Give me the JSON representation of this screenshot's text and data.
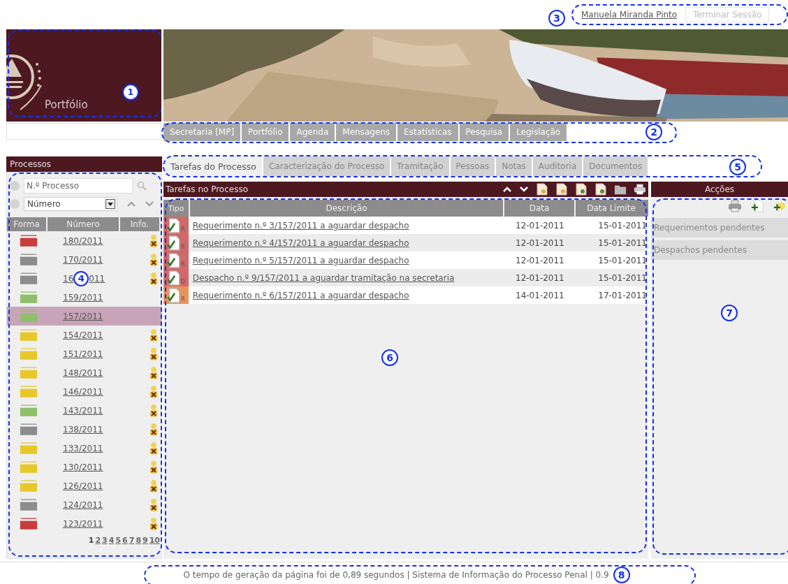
{
  "user": {
    "name": "Manuela Miranda Pinto",
    "logout": "Terminar Sessão",
    "callout": "3"
  },
  "brand": {
    "title": "Portfólio",
    "callout": "1"
  },
  "nav": {
    "callout": "2",
    "items": [
      {
        "label": "Secretaria [MP]"
      },
      {
        "label": "Portfólio"
      },
      {
        "label": "Agenda"
      },
      {
        "label": "Mensagens"
      },
      {
        "label": "Estatísticas"
      },
      {
        "label": "Pesquisa"
      },
      {
        "label": "Legislação"
      }
    ]
  },
  "processes": {
    "title": "Processos",
    "search_placeholder": "N.º Processo",
    "sort_value": "Número",
    "callout": "4",
    "columns": [
      "Forma",
      "Número",
      "Info."
    ],
    "rows": [
      {
        "number_parts": [
          "180/2011"
        ],
        "color": "#c83c3c",
        "info": true,
        "selected": false
      },
      {
        "number_parts": [
          "170/2011"
        ],
        "color": "#8c8c8c",
        "info": true,
        "selected": false
      },
      {
        "number_parts": [
          "16",
          "011"
        ],
        "color": "#8c8c8c",
        "info": true,
        "selected": false
      },
      {
        "number_parts": [
          "159/2011"
        ],
        "color": "#8fbf6a",
        "info": false,
        "selected": false
      },
      {
        "number_parts": [
          "157/2011"
        ],
        "color": "#8fbf6a",
        "info": false,
        "selected": true
      },
      {
        "number_parts": [
          "154/2011"
        ],
        "color": "#e6c82a",
        "info": true,
        "selected": false
      },
      {
        "number_parts": [
          "151/2011"
        ],
        "color": "#e6c82a",
        "info": true,
        "selected": false
      },
      {
        "number_parts": [
          "148/2011"
        ],
        "color": "#e6c82a",
        "info": true,
        "selected": false
      },
      {
        "number_parts": [
          "146/2011"
        ],
        "color": "#e6c82a",
        "info": true,
        "selected": false
      },
      {
        "number_parts": [
          "143/2011"
        ],
        "color": "#8fbf6a",
        "info": true,
        "selected": false
      },
      {
        "number_parts": [
          "138/2011"
        ],
        "color": "#8c8c8c",
        "info": true,
        "selected": false
      },
      {
        "number_parts": [
          "133/2011"
        ],
        "color": "#e6c82a",
        "info": true,
        "selected": false
      },
      {
        "number_parts": [
          "130/2011"
        ],
        "color": "#e6c82a",
        "info": true,
        "selected": false
      },
      {
        "number_parts": [
          "126/2011"
        ],
        "color": "#e6c82a",
        "info": true,
        "selected": false
      },
      {
        "number_parts": [
          "124/2011"
        ],
        "color": "#8c8c8c",
        "info": true,
        "selected": false
      },
      {
        "number_parts": [
          "123/2011"
        ],
        "color": "#c83c3c",
        "info": true,
        "selected": false
      }
    ],
    "pages": [
      {
        "label": "1",
        "selected": true
      },
      {
        "label": "2",
        "selected": false
      },
      {
        "label": "3",
        "selected": false
      },
      {
        "label": "4",
        "selected": false
      },
      {
        "label": "5",
        "selected": false
      },
      {
        "label": "6",
        "selected": false
      },
      {
        "label": "7",
        "selected": false
      },
      {
        "label": "8",
        "selected": false
      },
      {
        "label": "9",
        "selected": false
      },
      {
        "label": "10",
        "selected": false
      }
    ]
  },
  "tabs": {
    "callout": "5",
    "items": [
      {
        "label": "Tarefas do Processo",
        "selected": true
      },
      {
        "label": "Caracterização do Processo",
        "selected": false
      },
      {
        "label": "Tramitação",
        "selected": false
      },
      {
        "label": "Pessoas",
        "selected": false
      },
      {
        "label": "Notas",
        "selected": false
      },
      {
        "label": "Auditoria",
        "selected": false
      },
      {
        "label": "Documentos",
        "selected": false
      }
    ]
  },
  "tasks": {
    "title": "Tarefas no Processo",
    "callout": "6",
    "columns": [
      "Tipo",
      "Descrição",
      "Data",
      "Data Limite"
    ],
    "rows": [
      {
        "letter": "R",
        "color": "#d06a6a",
        "description": "Requerimento n.º 3/157/2011 a aguardar despacho",
        "date": "12-01-2011",
        "deadline": "15-01-2011"
      },
      {
        "letter": "R",
        "color": "#d06a6a",
        "description": "Requerimento n.º 4/157/2011 a aguardar despacho",
        "date": "12-01-2011",
        "deadline": "15-01-2011"
      },
      {
        "letter": "R",
        "color": "#d06a6a",
        "description": "Requerimento n.º 5/157/2011 a aguardar despacho",
        "date": "12-01-2011",
        "deadline": "15-01-2011"
      },
      {
        "letter": "D",
        "color": "#d06a6a",
        "description": "Despacho n.º 9/157/2011 a aguardar tramitação na secretaria",
        "date": "12-01-2011",
        "deadline": "15-01-2011"
      },
      {
        "letter": "R",
        "color": "#e8935a",
        "description": "Requerimento n.º 6/157/2011 a aguardar despacho",
        "date": "14-01-2011",
        "deadline": "17-01-2011"
      }
    ]
  },
  "actions": {
    "title": "Acções",
    "callout": "7",
    "buttons": [
      {
        "label": "Requerimentos pendentes",
        "disabled": true
      },
      {
        "label": "Despachos pendentes",
        "disabled": true
      }
    ]
  },
  "footer": {
    "text": "O tempo de geração da página foi de 0,89 segundos | Sistema de Informação do Processo Penal | 0.9",
    "callout": "8"
  }
}
